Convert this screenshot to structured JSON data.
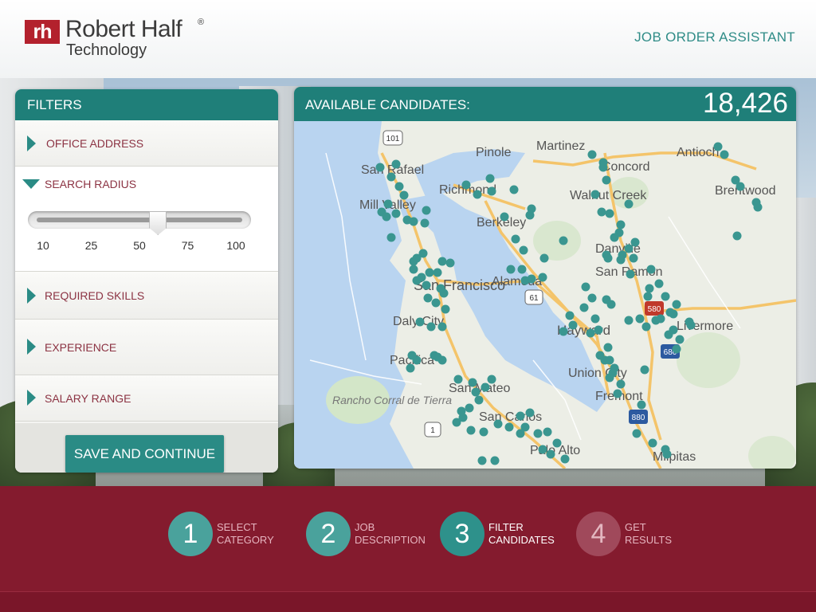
{
  "header": {
    "logo_mark": "rh",
    "logo_name": "Robert Half",
    "logo_reg": "®",
    "logo_sub": "Technology",
    "app_title": "JOB ORDER ASSISTANT"
  },
  "filters": {
    "title": "FILTERS",
    "office_address": "OFFICE ADDRESS",
    "search_radius": {
      "label": "SEARCH RADIUS",
      "ticks": [
        "10",
        "25",
        "50",
        "75",
        "100"
      ],
      "value_fraction": 0.59
    },
    "required_skills": "REQUIRED SKILLS",
    "experience": "EXPERIENCE",
    "salary_range": "SALARY RANGE",
    "save_button": "SAVE AND CONTINUE"
  },
  "map": {
    "label": "AVAILABLE CANDIDATES:",
    "count": "18,426",
    "places": [
      "San Rafael",
      "Richmond",
      "Pinole",
      "Martinez",
      "Concord",
      "Antioch",
      "Brentwood",
      "Mill Valley",
      "Berkeley",
      "Walnut Creek",
      "Danville",
      "San Ramon",
      "San Francisco",
      "Alameda",
      "Daly City",
      "Hayward",
      "Livermore",
      "Pacifica",
      "San Mateo",
      "Union City",
      "Fremont",
      "Rancho Corral de Tierra",
      "San Carlos",
      "Palo Alto",
      "Milpitas"
    ],
    "highway_shields": [
      "101",
      "61",
      "1",
      "680",
      "880",
      "580"
    ]
  },
  "steps": [
    {
      "num": "1",
      "label": "SELECT\nCATEGORY",
      "state": "done"
    },
    {
      "num": "2",
      "label": "JOB\nDESCRIPTION",
      "state": "done"
    },
    {
      "num": "3",
      "label": "FILTER\nCANDIDATES",
      "state": "current"
    },
    {
      "num": "4",
      "label": "GET\nRESULTS",
      "state": "todo"
    }
  ],
  "colors": {
    "teal": "#1f7f79",
    "teal_light": "#4aa29c",
    "maroon": "#841b2e",
    "step_todo": "#a0495b",
    "brand_red": "#b3212d"
  }
}
